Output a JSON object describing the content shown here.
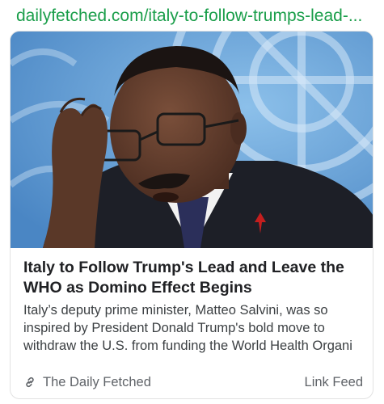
{
  "url_text": "dailyfetched.com/italy-to-follow-trumps-lead-...",
  "article": {
    "headline": "Italy to Follow Trump's Lead and Leave the WHO as Domino Effect Begins",
    "snippet": "Italy’s deputy prime minister, Matteo Salvini, was so inspired by President Donald Trump's bold move to withdraw the U.S. from funding the World Health Organi",
    "source_name": "The Daily Fetched",
    "link_feed_label": "Link Feed"
  },
  "icons": {
    "source": "link-icon"
  },
  "colors": {
    "url_green": "#1a9e4a",
    "headline": "#202124",
    "secondary_text": "#5f6368",
    "photo_background_blue": "#5b9bd3"
  }
}
